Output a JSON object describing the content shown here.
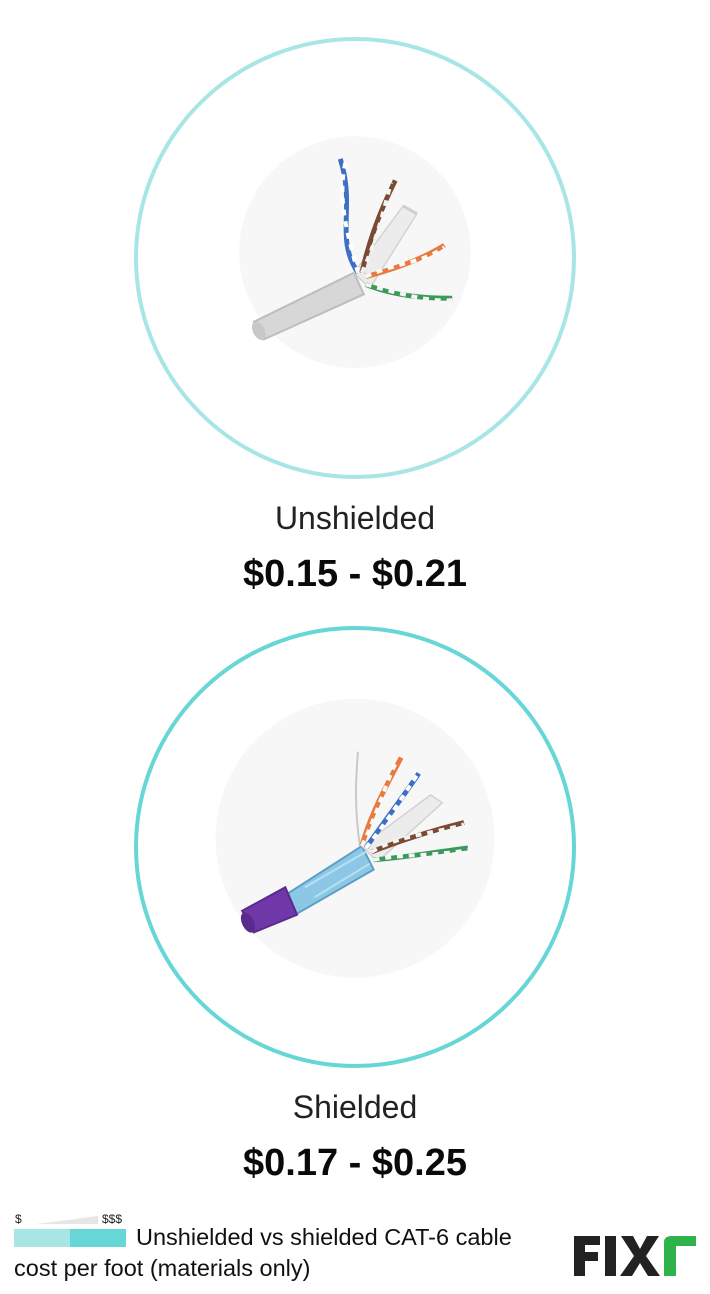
{
  "items": [
    {
      "label": "Unshielded",
      "price": "$0.15 - $0.21",
      "circle_color": "#a8e6e6",
      "icon": "unshielded-cable-icon"
    },
    {
      "label": "Shielded",
      "price": "$0.17 - $0.25",
      "circle_color": "#66d6d6",
      "icon": "shielded-cable-icon"
    }
  ],
  "legend": {
    "low": "$",
    "high": "$$$",
    "caption": "Unshielded vs shielded CAT-6 cable cost per foot (materials only)",
    "bar_colors": [
      "#a8e6e6",
      "#66d6d6"
    ]
  },
  "brand": {
    "name": "FIXr",
    "text_color": "#222222",
    "accent_color": "#2db34a"
  }
}
